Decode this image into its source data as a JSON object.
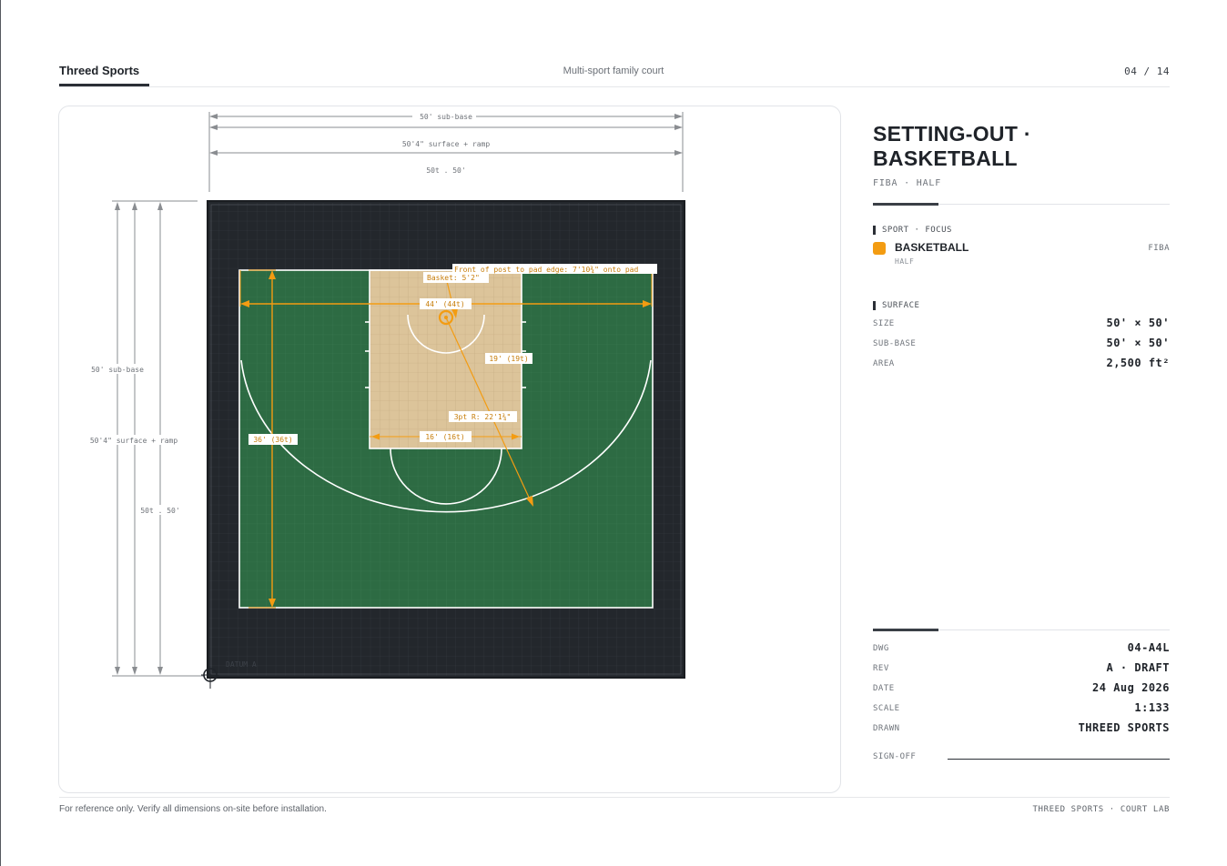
{
  "header": {
    "brand": "Threed Sports",
    "project": "Multi-sport family court",
    "page": "04 / 14"
  },
  "drawing": {
    "top_dims": {
      "sub_base": "50' sub-base",
      "surface": "50'4\" surface + ramp",
      "tiles": "50t . 50'"
    },
    "side_dims": {
      "sub_base": "50' sub-base",
      "surface": "50'4\" surface + ramp",
      "tiles": "50t . 50'"
    },
    "annotations": {
      "post_note": "Front of post to pad edge: 7'10¾\" onto pad",
      "basket": "Basket: 5'2\"",
      "width": "44' (44t)",
      "key_depth": "19' (19t)",
      "three_pt": "3pt R: 22'1¾\"",
      "key_width": "16' (16t)",
      "court_depth": "36' (36t)",
      "datum": "DATUM A"
    },
    "colors": {
      "pad": "#23272c",
      "court": "#2d6b43",
      "key": "#dcc49a",
      "line": "#ffffff",
      "accent": "#f39c12",
      "dim": "#8a8d91"
    }
  },
  "panel": {
    "title": "SETTING-OUT · BASKETBALL",
    "subtitle": "FIBA · HALF",
    "sport_focus": {
      "heading": "SPORT · FOCUS",
      "name": "BASKETBALL",
      "variant": "HALF",
      "standard": "FIBA",
      "swatch_color": "#f39c12"
    },
    "surface": {
      "heading": "SURFACE",
      "rows": [
        {
          "label": "SIZE",
          "value": "50' × 50'"
        },
        {
          "label": "SUB-BASE",
          "value": "50' × 50'"
        },
        {
          "label": "AREA",
          "value": "2,500 ft²"
        }
      ]
    },
    "title_block": {
      "rows": [
        {
          "label": "DWG",
          "value": "04-A4L"
        },
        {
          "label": "REV",
          "value": "A · DRAFT"
        },
        {
          "label": "DATE",
          "value": "24 Aug 2026"
        },
        {
          "label": "SCALE",
          "value": "1:133"
        },
        {
          "label": "DRAWN",
          "value": "THREED SPORTS"
        }
      ],
      "signoff_label": "SIGN-OFF"
    }
  },
  "footer": {
    "disclaimer": "For reference only. Verify all dimensions on-site before installation.",
    "credit": "THREED SPORTS · COURT LAB"
  }
}
